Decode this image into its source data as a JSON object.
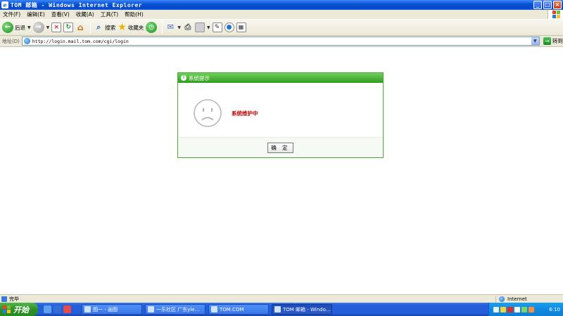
{
  "window": {
    "title": "TOM 邮箱 - Windows Internet Explorer",
    "buttons": {
      "minimize": "_",
      "maximize": "□",
      "close": "×"
    }
  },
  "menu": [
    "文件(F)",
    "编辑(E)",
    "查看(V)",
    "收藏(A)",
    "工具(T)",
    "帮助(H)"
  ],
  "toolbar": {
    "back_label": "后退",
    "search_label": "搜索",
    "favorites_label": "收藏夹"
  },
  "address": {
    "label": "地址(D)",
    "url": "http://login.mail.tom.com/cgi/login",
    "go_label": "转到"
  },
  "dialog": {
    "title": "系统提示",
    "message": "系统维护中",
    "ok_label": "确 定"
  },
  "status": {
    "text": "完毕",
    "zone": "Internet"
  },
  "taskbar": {
    "start_label": "开始",
    "tasks": [
      "图一 - 画图",
      "一乐社区 广东yle...",
      "TOM.COM",
      "TOM 邮箱 - Windo..."
    ],
    "clock": "6:10"
  }
}
